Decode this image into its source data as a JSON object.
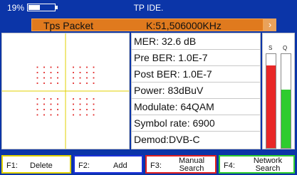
{
  "status_bar": {
    "battery_percent": "19%",
    "battery_level": 0.45,
    "title": "TP IDE."
  },
  "header": {
    "mode": "Tps Packet",
    "frequency": "K:51,506000KHz",
    "arrow_icon": "chevron-right-icon"
  },
  "constellation": {
    "modulation": "64QAM",
    "grid_color": "#e0d000",
    "dot_color": "#e02020"
  },
  "info": {
    "rows": [
      "MER: 32.6 dB",
      "Pre BER: 1.0E-7",
      "Post BER: 1.0E-7",
      "Power: 83dBuV",
      "Modulate: 64QAM",
      "Symbol rate: 6900",
      "Demod:DVB-C"
    ]
  },
  "meters": {
    "s_label": "S",
    "q_label": "Q",
    "s_level": 0.88,
    "q_level": 0.62,
    "s_color": "#e82828",
    "q_color": "#2ecc2e"
  },
  "function_keys": [
    {
      "key": "F1:",
      "label": "Delete",
      "color": "#e0d000"
    },
    {
      "key": "F2:",
      "label": "Add",
      "color": "#1a2fd8"
    },
    {
      "key": "F3:",
      "label_line1": "Manual",
      "label_line2": "Search",
      "color": "#e02020"
    },
    {
      "key": "F4:",
      "label_line1": "Network",
      "label_line2": "Search",
      "color": "#2ecc2e"
    }
  ]
}
